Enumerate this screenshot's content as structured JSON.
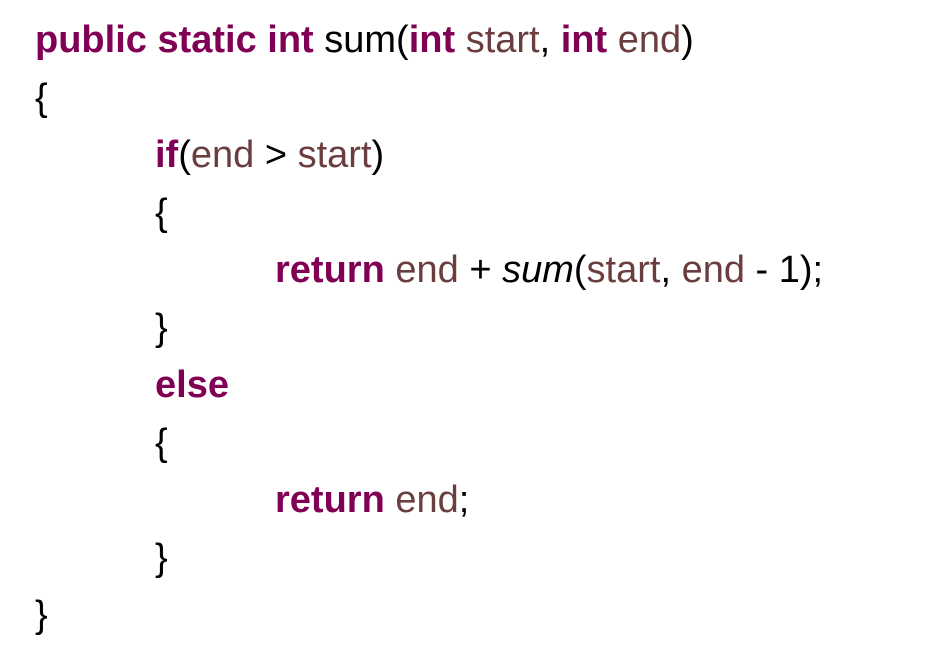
{
  "colors": {
    "keyword": "#7f0055",
    "variable": "#6a3e3e",
    "plain": "#000000"
  },
  "code_lines": [
    {
      "indent": 0,
      "tokens": [
        {
          "t": "public static int",
          "c": "kw"
        },
        {
          "t": " sum(",
          "c": "plain"
        },
        {
          "t": "int",
          "c": "kw"
        },
        {
          "t": " start",
          "c": "var"
        },
        {
          "t": ", ",
          "c": "plain"
        },
        {
          "t": "int",
          "c": "kw"
        },
        {
          "t": " end",
          "c": "var"
        },
        {
          "t": ")",
          "c": "plain"
        }
      ]
    },
    {
      "indent": 0,
      "tokens": [
        {
          "t": "{",
          "c": "plain"
        }
      ]
    },
    {
      "indent": 1,
      "tokens": [
        {
          "t": "if",
          "c": "kw"
        },
        {
          "t": "(",
          "c": "plain"
        },
        {
          "t": "end",
          "c": "var"
        },
        {
          "t": " > ",
          "c": "plain"
        },
        {
          "t": "start",
          "c": "var"
        },
        {
          "t": ")",
          "c": "plain"
        }
      ]
    },
    {
      "indent": 1,
      "tokens": [
        {
          "t": "{",
          "c": "plain"
        }
      ]
    },
    {
      "indent": 2,
      "tokens": [
        {
          "t": "return",
          "c": "kw"
        },
        {
          "t": " end",
          "c": "var"
        },
        {
          "t": " + ",
          "c": "plain"
        },
        {
          "t": "sum",
          "c": "call"
        },
        {
          "t": "(",
          "c": "plain"
        },
        {
          "t": "start",
          "c": "var"
        },
        {
          "t": ", ",
          "c": "plain"
        },
        {
          "t": "end",
          "c": "var"
        },
        {
          "t": " - 1);",
          "c": "plain"
        }
      ]
    },
    {
      "indent": 1,
      "tokens": [
        {
          "t": "}",
          "c": "plain"
        }
      ]
    },
    {
      "indent": 1,
      "tokens": [
        {
          "t": "else",
          "c": "kw"
        }
      ]
    },
    {
      "indent": 1,
      "tokens": [
        {
          "t": "{",
          "c": "plain"
        }
      ]
    },
    {
      "indent": 2,
      "tokens": [
        {
          "t": "return",
          "c": "kw"
        },
        {
          "t": " end",
          "c": "var"
        },
        {
          "t": ";",
          "c": "plain"
        }
      ]
    },
    {
      "indent": 1,
      "tokens": [
        {
          "t": "}",
          "c": "plain"
        }
      ]
    },
    {
      "indent": 0,
      "tokens": [
        {
          "t": "}",
          "c": "plain"
        }
      ]
    }
  ]
}
